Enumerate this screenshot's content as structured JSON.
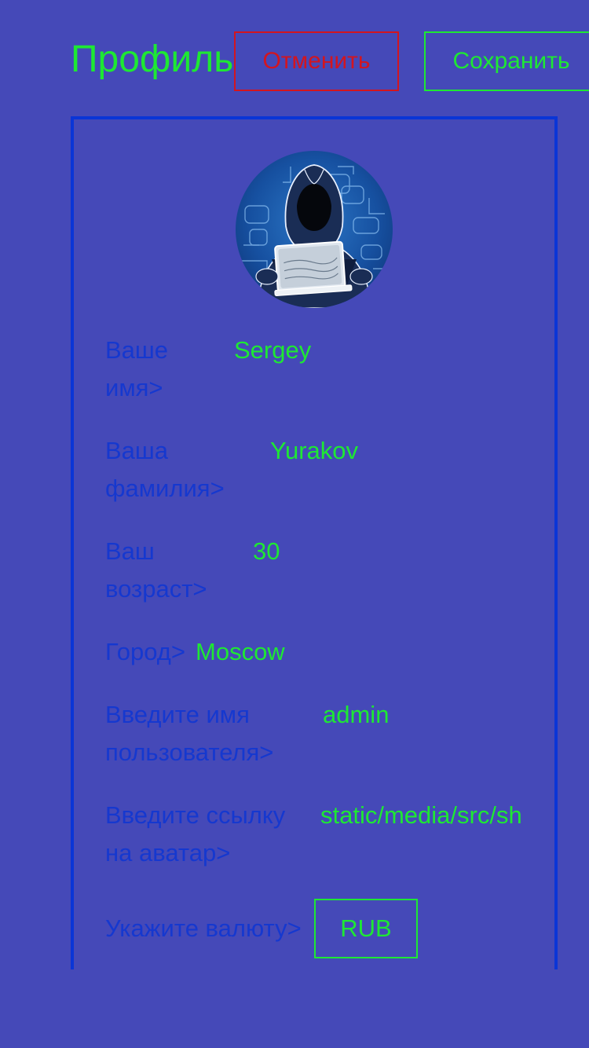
{
  "header": {
    "title": "Профиль",
    "cancel_label": "Отменить",
    "save_label": "Сохранить"
  },
  "profile": {
    "first_name": {
      "label_line1": "Ваше",
      "label_line2": "имя>",
      "value": "Sergey"
    },
    "last_name": {
      "label_line1": "Ваша",
      "label_line2": "фамилия>",
      "value": "Yurakov"
    },
    "age": {
      "label_line1": "Ваш",
      "label_line2": "возраст>",
      "value": "30"
    },
    "city": {
      "label": "Город>",
      "value": "Moscow"
    },
    "username": {
      "label_line1": "Введите имя",
      "label_line2": "пользователя>",
      "value": "admin"
    },
    "avatar_link": {
      "label_line1": "Введите ссылку",
      "label_line2": "на аватар>",
      "value": "static/media/src/sh"
    },
    "currency": {
      "label": "Укажите валюту>",
      "value": "RUB"
    }
  },
  "colors": {
    "background": "#4549b8",
    "label": "#1538cf",
    "value": "#1ee833",
    "cancel": "#d3151f",
    "card_border": "#0a35d6"
  },
  "icons": {
    "avatar": "hacker-avatar-icon"
  }
}
